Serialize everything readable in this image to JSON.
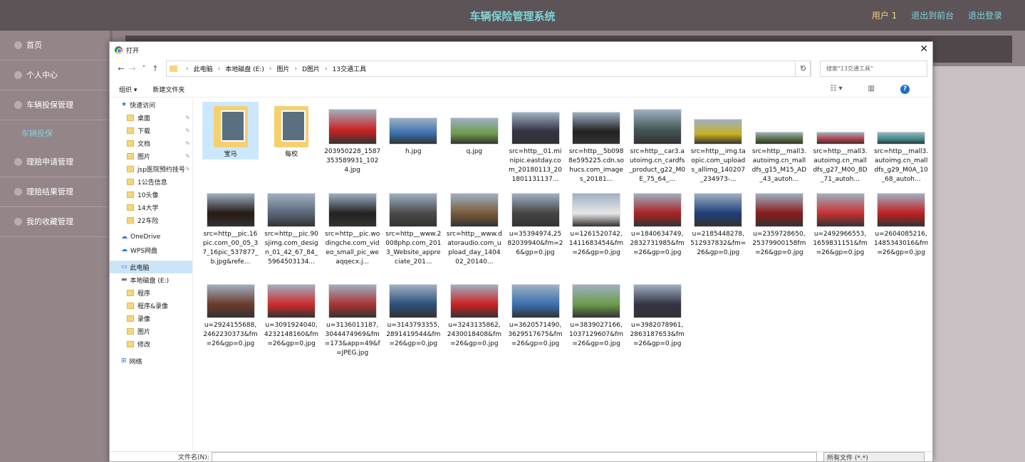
{
  "app": {
    "title": "车辆保险管理系统",
    "user": "用户 1",
    "front": "退出到前台",
    "logout": "退出登录"
  },
  "sidebar": {
    "items": [
      {
        "label": "首页"
      },
      {
        "label": "个人中心"
      },
      {
        "label": "车辆投保管理"
      },
      {
        "label": "车辆投保",
        "sub": true
      },
      {
        "label": "理赔申请管理"
      },
      {
        "label": "理赔结果管理"
      },
      {
        "label": "我的收藏管理"
      }
    ]
  },
  "dialog": {
    "title": "打开",
    "path": [
      "此电脑",
      "本地磁盘 (E:)",
      "图片",
      "D图片",
      "13交通工具"
    ],
    "search_placeholder": "搜索\"13交通工具\"",
    "organize": "组织 ▾",
    "new_folder": "新建文件夹",
    "filename_label": "文件名(N):",
    "filetype": "所有文件 (*.*)",
    "tree": [
      {
        "label": "快速访问",
        "kind": "star"
      },
      {
        "label": "桌面",
        "pin": true
      },
      {
        "label": "下载",
        "pin": true
      },
      {
        "label": "文档",
        "pin": true
      },
      {
        "label": "图片",
        "pin": true
      },
      {
        "label": "jsp医院预约挂号",
        "pin": true
      },
      {
        "label": "1公告信息"
      },
      {
        "label": "10头像"
      },
      {
        "label": "14大学"
      },
      {
        "label": "22车险"
      },
      {
        "label": "OneDrive",
        "kind": "cloud"
      },
      {
        "label": "WPS网盘",
        "kind": "cloud"
      },
      {
        "label": "此电脑",
        "kind": "pc",
        "selected": true
      },
      {
        "label": "本地磁盘 (E:)",
        "kind": "disk"
      },
      {
        "label": "程序"
      },
      {
        "label": "程序&录像"
      },
      {
        "label": "录像"
      },
      {
        "label": "图片"
      },
      {
        "label": "修改"
      },
      {
        "label": "网络",
        "kind": "net"
      }
    ],
    "files": [
      {
        "name": "宝马",
        "folder": true
      },
      {
        "name": "每校",
        "folder": true
      },
      {
        "name": "203950228_1587353589931_1024.jpg"
      },
      {
        "name": "h.jpg"
      },
      {
        "name": "q.jpg"
      },
      {
        "name": "src=http__01.minipic.eastday.com_20180113_201801131137..."
      },
      {
        "name": "src=http__5b0988e595225.cdn.sohucs.com_images_20181..."
      },
      {
        "name": "src=http__car3.autoimg.cn_cardfs_product_g22_M0E_75_64_..."
      },
      {
        "name": "src=http__img.taopic.com_uploads_allimg_140207_234973-..."
      },
      {
        "name": "src=http__mall3.autoimg.cn_malldfs_g15_M15_AD_43_autoh..."
      },
      {
        "name": "src=http__mall3.autoimg.cn_malldfs_g27_M00_8D_71_autoh..."
      },
      {
        "name": "src=http__mall3.autoimg.cn_malldfs_g29_M0A_10_68_autoh..."
      },
      {
        "name": "src=http__pic.16pic.com_00_05_37_16pic_537877_b.jpg&refe..."
      },
      {
        "name": "src=http__pic.90sjimg.com_design_01_42_67_84_5964503134..."
      },
      {
        "name": "src=http__pic.wodingche.com_video_small_pic_weaqqecx.j..."
      },
      {
        "name": "src=http__www.2008php.com_2013_Website_appreciate_201..."
      },
      {
        "name": "src=http__www.datoraudio.com_upload_day_140402_20140..."
      },
      {
        "name": "u=35394974,2582039940&fm=26&gp=0.jpg"
      },
      {
        "name": "u=1261520742,1411683454&fm=26&gp=0.jpg"
      },
      {
        "name": "u=1840634749,2832731985&fm=26&gp=0.jpg"
      },
      {
        "name": "u=2185448278,512937832&fm=26&gp=0.jpg"
      },
      {
        "name": "u=2359728650,25379900158fm=26&gp=0.jpg"
      },
      {
        "name": "u=2492966553,1659831151&fm=26&gp=0.jpg"
      },
      {
        "name": "u=2604085216,1485343016&fm=26&gp=0.jpg"
      },
      {
        "name": "u=2924155688,2462230373&fm=26&gp=0.jpg"
      },
      {
        "name": "u=3091924040,4232148160&fm=26&gp=0.jpg"
      },
      {
        "name": "u=3136013187,3044474969&fm=173&app=49&f=JPEG.jpg"
      },
      {
        "name": "u=3143793355,2891419544&fm=26&gp=0.jpg"
      },
      {
        "name": "u=3243135862,2430018408&fm=26&gp=0.jpg"
      },
      {
        "name": "u=3620571490,3629517675&fm=26&gp=0.jpg"
      },
      {
        "name": "u=3839027166,1037129607&fm=26&gp=0.jpg"
      },
      {
        "name": "u=3982078961,2863187653&fm=26&gp=0.jpg"
      }
    ]
  }
}
